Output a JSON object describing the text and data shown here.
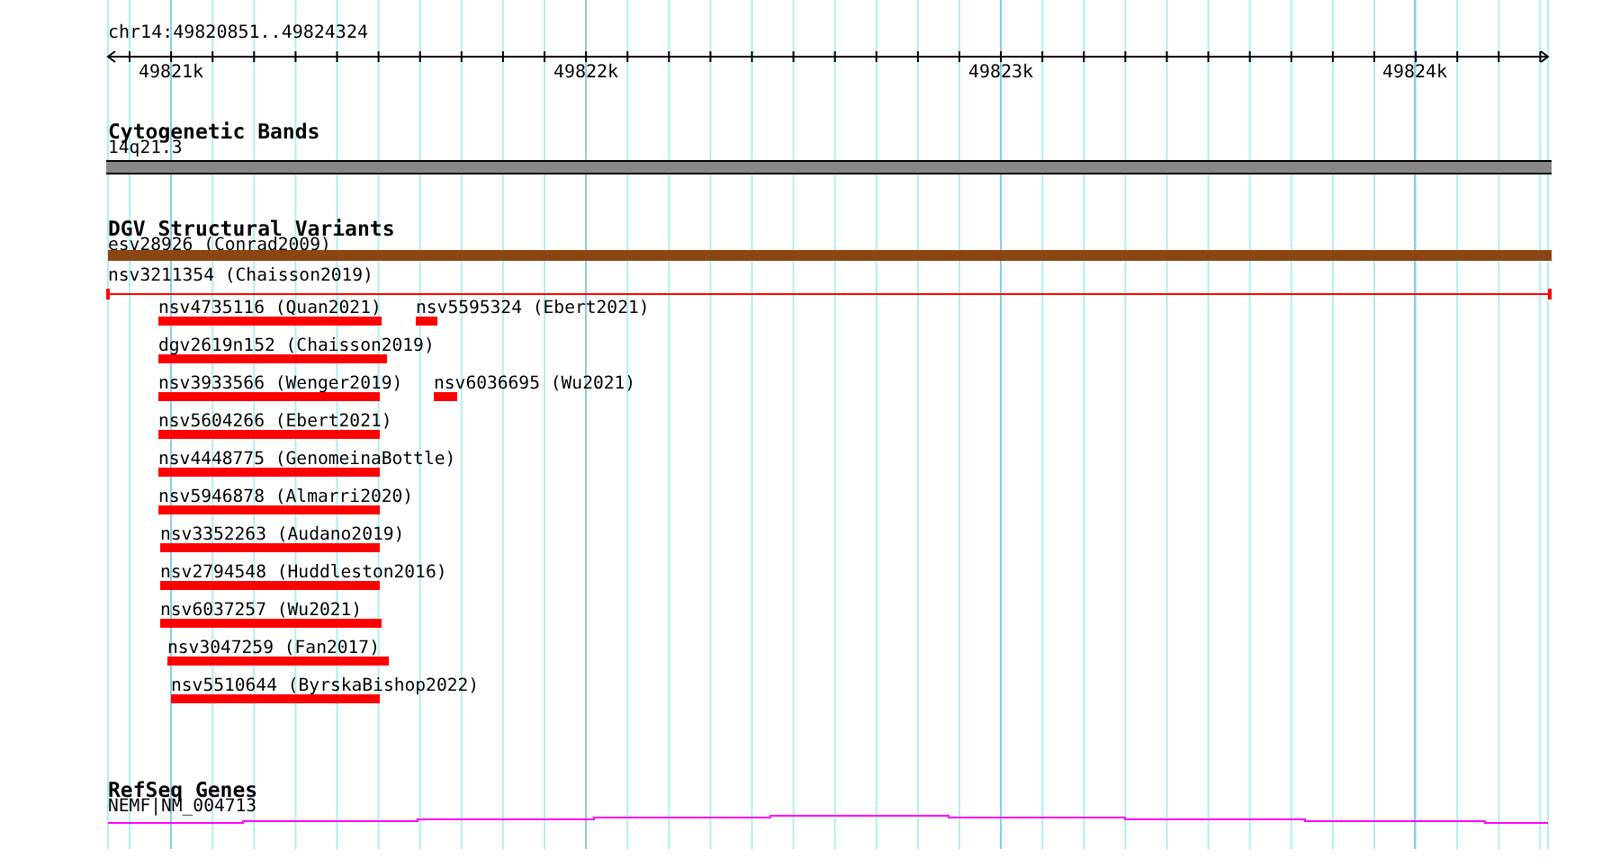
{
  "ruler": {
    "location": "chr14:49820851..49824324",
    "ticks": [
      "49821k",
      "49822k",
      "49823k",
      "49824k"
    ]
  },
  "tracks": [
    {
      "title": "Cytogenetic Bands",
      "kind": "bands",
      "features": [
        {
          "label": "14q21.3"
        }
      ]
    },
    {
      "title": "DGV Structural Variants",
      "kind": "variants",
      "features": [
        {
          "label": "esv28926 (Conrad2009)",
          "kind": "full-bar",
          "color": "#8b4513"
        },
        {
          "label": "nsv3211354 (Chaisson2019)",
          "kind": "span-line",
          "color": "#ff0000"
        },
        {
          "label": "nsv4735116 (Quan2021)",
          "kind": "bar",
          "color": "#ff0000"
        },
        {
          "label": "nsv5595324 (Ebert2021)",
          "kind": "bar",
          "color": "#ff0000"
        },
        {
          "label": "dgv2619n152 (Chaisson2019)",
          "kind": "bar",
          "color": "#ff0000"
        },
        {
          "label": "nsv3933566 (Wenger2019)",
          "kind": "bar",
          "color": "#ff0000"
        },
        {
          "label": "nsv6036695 (Wu2021)",
          "kind": "bar",
          "color": "#ff0000"
        },
        {
          "label": "nsv5604266 (Ebert2021)",
          "kind": "bar",
          "color": "#ff0000"
        },
        {
          "label": "nsv4448775 (GenomeinaBottle)",
          "kind": "bar",
          "color": "#ff0000"
        },
        {
          "label": "nsv5946878 (Almarri2020)",
          "kind": "bar",
          "color": "#ff0000"
        },
        {
          "label": "nsv3352263 (Audano2019)",
          "kind": "bar",
          "color": "#ff0000"
        },
        {
          "label": "nsv2794548 (Huddleston2016)",
          "kind": "bar",
          "color": "#ff0000"
        },
        {
          "label": "nsv6037257 (Wu2021)",
          "kind": "bar",
          "color": "#ff0000"
        },
        {
          "label": "nsv3047259 (Fan2017)",
          "kind": "bar",
          "color": "#ff0000"
        },
        {
          "label": "nsv5510644 (ByrskaBishop2022)",
          "kind": "bar",
          "color": "#ff0000"
        }
      ]
    },
    {
      "title": "RefSeq Genes",
      "kind": "genes",
      "features": [
        {
          "label": "NEMF|NM_004713"
        }
      ]
    }
  ]
}
